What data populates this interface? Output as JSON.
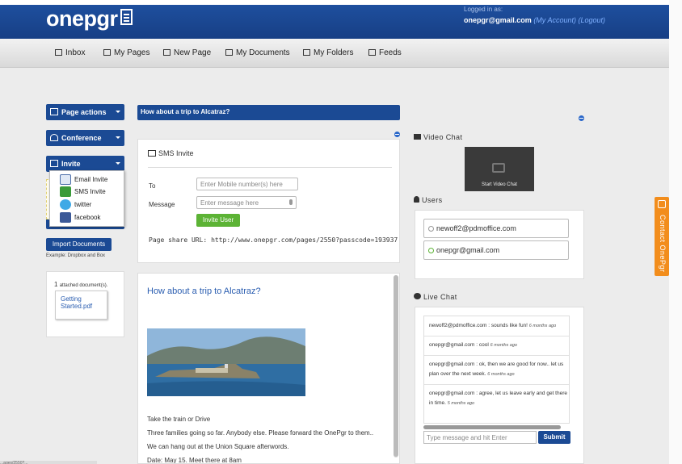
{
  "header": {
    "logo": "onepgr",
    "logged_in_label": "Logged in as:",
    "user_email": "onepgr@gmail.com",
    "my_account_link": "(My Account)",
    "logout_link": "(Logout)"
  },
  "nav": [
    {
      "label": "Inbox",
      "icon": "envelope-icon"
    },
    {
      "label": "My Pages",
      "icon": "book-icon"
    },
    {
      "label": "New Page",
      "icon": "file-icon"
    },
    {
      "label": "My Documents",
      "icon": "briefcase-icon"
    },
    {
      "label": "My Folders",
      "icon": "folder-icon"
    },
    {
      "label": "Feeds",
      "icon": "rss-icon"
    }
  ],
  "sidebar": {
    "page_actions": "Page actions",
    "conference": "Conference",
    "invite": "Invite",
    "invite_menu": [
      {
        "label": "Email Invite",
        "icon": "email-icon"
      },
      {
        "label": "SMS Invite",
        "icon": "sms-icon"
      },
      {
        "label": "twitter",
        "icon": "twitter-icon"
      },
      {
        "label": "facebook",
        "icon": "facebook-icon"
      }
    ],
    "import_button": "Import Documents",
    "import_note": "Example: Dropbox and Box",
    "attached_count": "1",
    "attached_label": "attached document(s).",
    "attached_file_line1": "Getting",
    "attached_file_line2": "Started.pdf"
  },
  "main": {
    "title": "How about a trip to Alcatraz?",
    "sms": {
      "heading": "SMS Invite",
      "to_label": "To",
      "to_placeholder": "Enter Mobile number(s) here",
      "message_label": "Message",
      "message_placeholder": "Enter message here",
      "invite_button": "Invite User",
      "share_url": "Page share URL: http://www.onepgr.com/pages/2550?passcode=193937"
    },
    "doc": {
      "title": "How about a trip to Alcatraz?",
      "lines": [
        "Take the train or Drive",
        "Three families going so far. Anybody else. Please forward the OnePgr to them..",
        "We can hang out at the Union Square afterwords.",
        "Date: May 15. Meet there at 8am"
      ]
    }
  },
  "right": {
    "video_heading": "Video Chat",
    "start_video": "Start Video Chat",
    "users_heading": "Users",
    "users": [
      "newoff2@pdmoffice.com",
      "onepgr@gmail.com"
    ],
    "chat_heading": "Live Chat",
    "messages": [
      {
        "text": "newoff2@pdmoffice.com : sounds like fun!",
        "time": "6 months ago"
      },
      {
        "text": "onepgr@gmail.com : cool",
        "time": "6 months ago"
      },
      {
        "text": "onepgr@gmail.com : ok, then we are good for now.. let us plan over the next week.",
        "time": "6 months ago"
      },
      {
        "text": "onepgr@gmail.com : agree, let us leave early and get there in time.",
        "time": "5 months ago"
      }
    ],
    "chat_placeholder": "Type message and hit Enter",
    "submit": "Submit"
  },
  "contact_tab": "Contact OnePgr",
  "status_text": "...ages/2550?...",
  "colors": {
    "brand": "#1b4a94",
    "accent_green": "#5cb335",
    "contact_orange": "#f28d1c"
  }
}
